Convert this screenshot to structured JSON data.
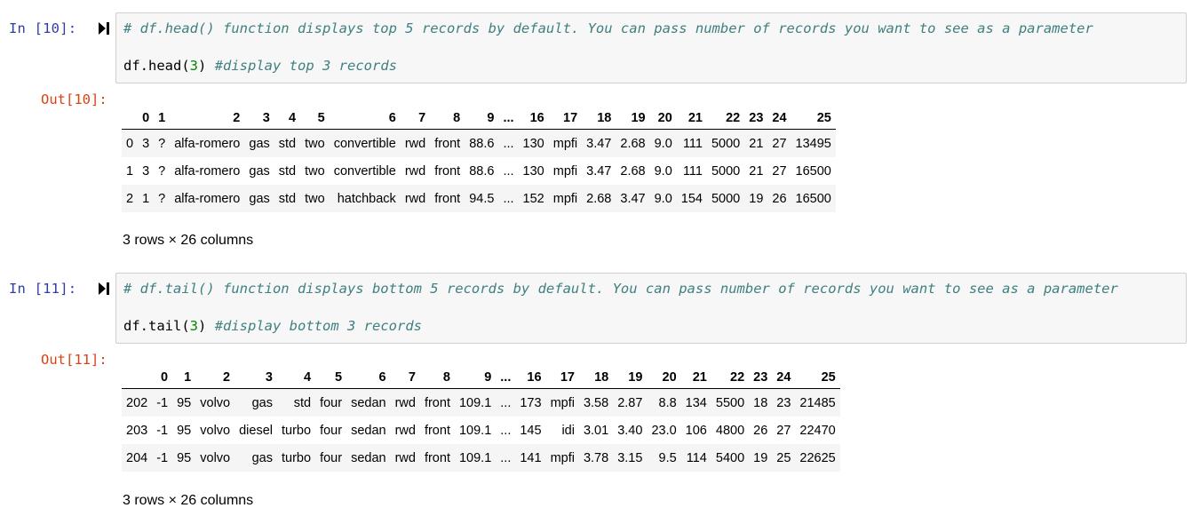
{
  "cells": [
    {
      "in_prompt": "In [10]:",
      "out_prompt": "Out[10]:",
      "code_comment": "# df.head() function displays top 5 records by default. You can pass number of records you want to see as a parameter",
      "code_call": "df.head(",
      "code_arg": "3",
      "code_close": ")",
      "code_inline_comment": "#display top 3 records",
      "shape": "3 rows × 26 columns",
      "table": {
        "columns": [
          "0",
          "1",
          "2",
          "3",
          "4",
          "5",
          "6",
          "7",
          "8",
          "9",
          "...",
          "16",
          "17",
          "18",
          "19",
          "20",
          "21",
          "22",
          "23",
          "24",
          "25"
        ],
        "rows": [
          {
            "index": "0",
            "cells": [
              "3",
              "?",
              "alfa-romero",
              "gas",
              "std",
              "two",
              "convertible",
              "rwd",
              "front",
              "88.6",
              "...",
              "130",
              "mpfi",
              "3.47",
              "2.68",
              "9.0",
              "111",
              "5000",
              "21",
              "27",
              "13495"
            ]
          },
          {
            "index": "1",
            "cells": [
              "3",
              "?",
              "alfa-romero",
              "gas",
              "std",
              "two",
              "convertible",
              "rwd",
              "front",
              "88.6",
              "...",
              "130",
              "mpfi",
              "3.47",
              "2.68",
              "9.0",
              "111",
              "5000",
              "21",
              "27",
              "16500"
            ]
          },
          {
            "index": "2",
            "cells": [
              "1",
              "?",
              "alfa-romero",
              "gas",
              "std",
              "two",
              "hatchback",
              "rwd",
              "front",
              "94.5",
              "...",
              "152",
              "mpfi",
              "2.68",
              "3.47",
              "9.0",
              "154",
              "5000",
              "19",
              "26",
              "16500"
            ]
          }
        ]
      }
    },
    {
      "in_prompt": "In [11]:",
      "out_prompt": "Out[11]:",
      "code_comment": "# df.tail() function displays bottom 5 records by default. You can pass number of records you want to see as a parameter",
      "code_call": "df.tail(",
      "code_arg": "3",
      "code_close": ")",
      "code_inline_comment": "#display bottom 3 records",
      "shape": "3 rows × 26 columns",
      "table": {
        "columns": [
          "0",
          "1",
          "2",
          "3",
          "4",
          "5",
          "6",
          "7",
          "8",
          "9",
          "...",
          "16",
          "17",
          "18",
          "19",
          "20",
          "21",
          "22",
          "23",
          "24",
          "25"
        ],
        "rows": [
          {
            "index": "202",
            "cells": [
              "-1",
              "95",
              "volvo",
              "gas",
              "std",
              "four",
              "sedan",
              "rwd",
              "front",
              "109.1",
              "...",
              "173",
              "mpfi",
              "3.58",
              "2.87",
              "8.8",
              "134",
              "5500",
              "18",
              "23",
              "21485"
            ]
          },
          {
            "index": "203",
            "cells": [
              "-1",
              "95",
              "volvo",
              "diesel",
              "turbo",
              "four",
              "sedan",
              "rwd",
              "front",
              "109.1",
              "...",
              "145",
              "idi",
              "3.01",
              "3.40",
              "23.0",
              "106",
              "4800",
              "26",
              "27",
              "22470"
            ]
          },
          {
            "index": "204",
            "cells": [
              "-1",
              "95",
              "volvo",
              "gas",
              "turbo",
              "four",
              "sedan",
              "rwd",
              "front",
              "109.1",
              "...",
              "141",
              "mpfi",
              "3.78",
              "3.15",
              "9.5",
              "114",
              "5400",
              "19",
              "25",
              "22625"
            ]
          }
        ]
      }
    }
  ],
  "colors": {
    "in_prompt": "#303f9f",
    "out_prompt": "#d84315",
    "comment": "#408080",
    "number": "#008800",
    "input_bg": "#f7f7f7",
    "row_stripe": "#f5f5f5"
  }
}
